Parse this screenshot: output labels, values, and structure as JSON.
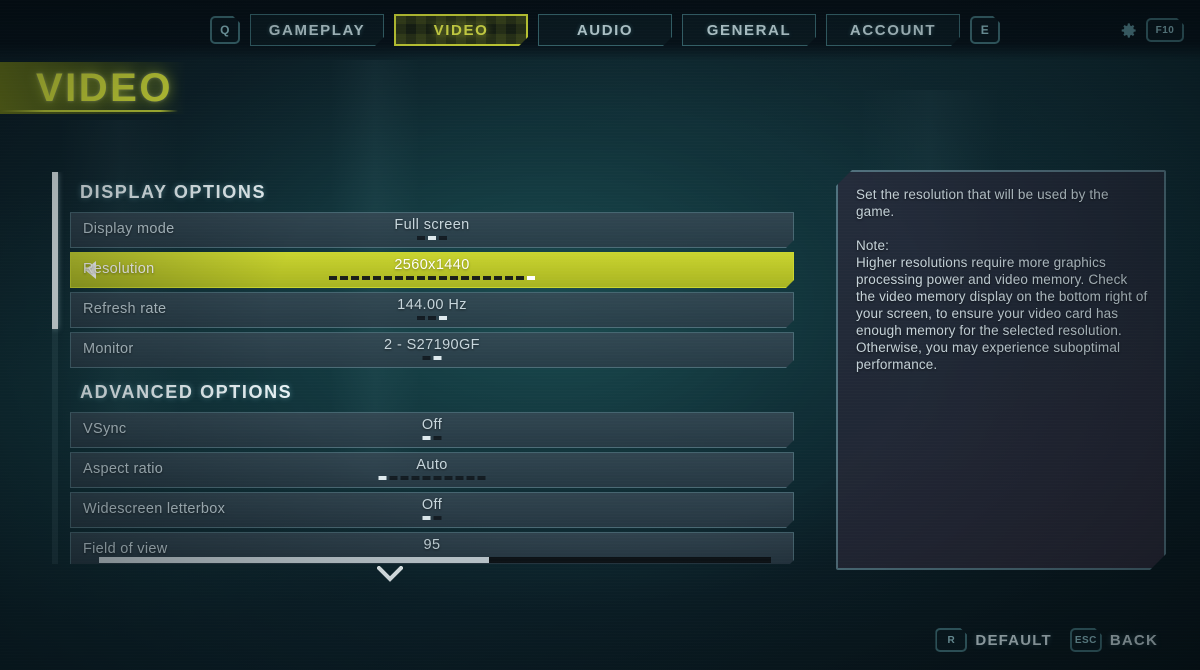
{
  "header": {
    "left_key": "Q",
    "right_key": "E",
    "tabs": [
      {
        "label": "GAMEPLAY",
        "active": false
      },
      {
        "label": "VIDEO",
        "active": true
      },
      {
        "label": "AUDIO",
        "active": false
      },
      {
        "label": "GENERAL",
        "active": false
      },
      {
        "label": "ACCOUNT",
        "active": false
      }
    ],
    "settings_icon": "gear-icon",
    "settings_key": "F10"
  },
  "page": {
    "title": "VIDEO"
  },
  "groups": [
    {
      "title": "DISPLAY OPTIONS",
      "rows": [
        {
          "label": "Display mode",
          "value": "Full screen",
          "type": "options",
          "dots_total": 3,
          "dots_index": 1,
          "selected": false
        },
        {
          "label": "Resolution",
          "value": "2560x1440",
          "type": "options",
          "dots_total": 19,
          "dots_index": 18,
          "selected": true
        },
        {
          "label": "Refresh rate",
          "value": "144.00 Hz",
          "type": "options",
          "dots_total": 3,
          "dots_index": 2,
          "selected": false
        },
        {
          "label": "Monitor",
          "value": "2 - S27190GF",
          "type": "options",
          "dots_total": 2,
          "dots_index": 1,
          "selected": false
        }
      ]
    },
    {
      "title": "ADVANCED OPTIONS",
      "rows": [
        {
          "label": "VSync",
          "value": "Off",
          "type": "options",
          "dots_total": 2,
          "dots_index": 0,
          "selected": false
        },
        {
          "label": "Aspect ratio",
          "value": "Auto",
          "type": "options",
          "dots_total": 10,
          "dots_index": 0,
          "selected": false
        },
        {
          "label": "Widescreen letterbox",
          "value": "Off",
          "type": "options",
          "dots_total": 2,
          "dots_index": 0,
          "selected": false
        },
        {
          "label": "Field of view",
          "value": "95",
          "type": "slider",
          "fill_percent": 58,
          "selected": false
        }
      ]
    }
  ],
  "description": {
    "paragraph_1": "Set the resolution that will be used by the game.",
    "paragraph_2": "Note:",
    "paragraph_3": "Higher resolutions require more graphics processing power and video memory. Check the video memory display on the bottom right of your screen, to ensure your video card has enough memory for the selected resolution. Otherwise, you may experience suboptimal performance."
  },
  "footer": {
    "hints": [
      {
        "key": "R",
        "label": "DEFAULT"
      },
      {
        "key": "ESC",
        "label": "BACK"
      }
    ]
  },
  "colors": {
    "accent_yellow": "#c9d430",
    "title_yellow": "#e2ee3c",
    "teal_border": "#3a6a72",
    "row_bg": "#3a4a56",
    "text_primary": "#c7d6dc",
    "panel_bg": "#262c3c"
  },
  "scroll": {
    "thumb_top_percent": 0,
    "thumb_height_percent": 40
  }
}
